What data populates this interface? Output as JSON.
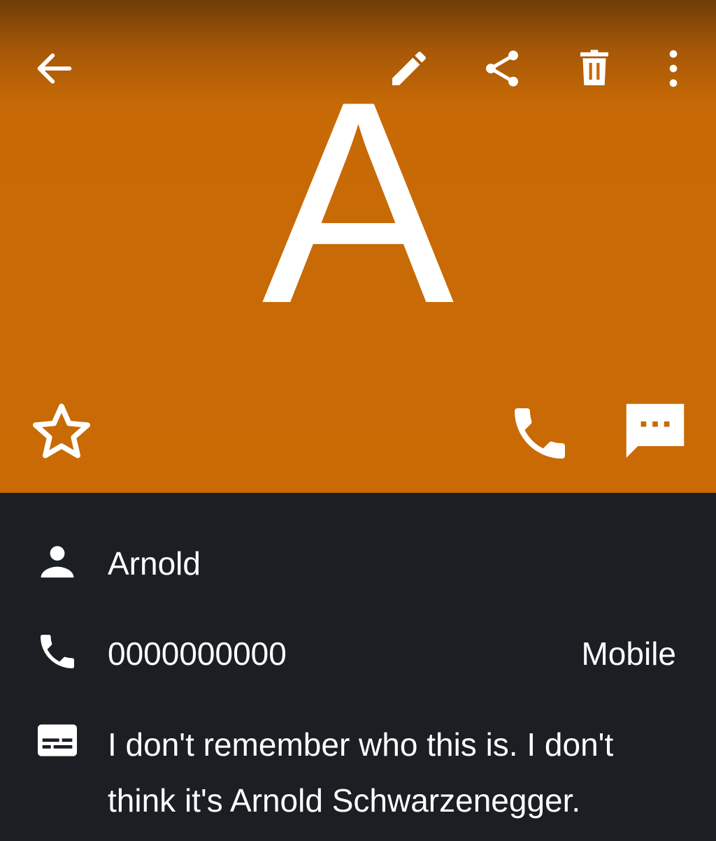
{
  "header": {
    "avatar_letter": "A",
    "background_color": "#c96a05",
    "toolbar": {
      "back_icon": "arrow-left-icon",
      "edit_icon": "pencil-icon",
      "share_icon": "share-icon",
      "delete_icon": "trash-icon",
      "more_icon": "more-vertical-icon"
    },
    "actions": {
      "favorite_icon": "star-outline-icon",
      "call_icon": "phone-icon",
      "message_icon": "sms-icon"
    }
  },
  "details": {
    "name": {
      "icon": "person-icon",
      "value": "Arnold"
    },
    "phone": {
      "icon": "phone-icon",
      "number": "0000000000",
      "type": "Mobile"
    },
    "note": {
      "icon": "notes-icon",
      "line1": "I don't remember who this is. I don't",
      "line2": "think it's Arnold Schwarzenegger."
    }
  }
}
